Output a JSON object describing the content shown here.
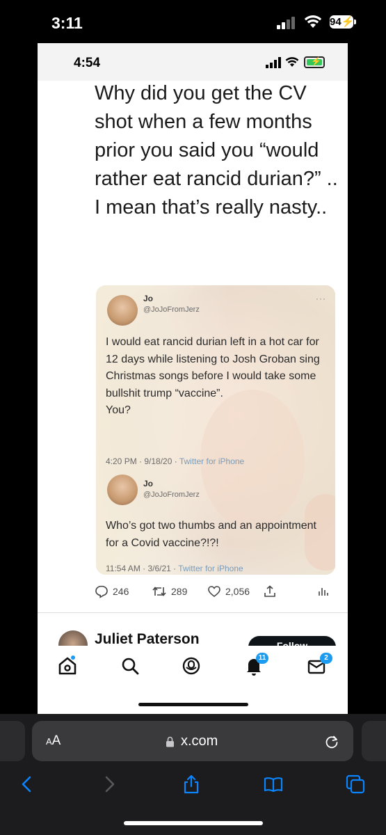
{
  "device_status": {
    "time": "3:11",
    "battery": "94"
  },
  "screenshot": {
    "status": {
      "time": "4:54"
    },
    "tweet": {
      "text": "Why did you get the CV shot when a few months prior you said you “would rather eat rancid durian?” .. I mean that’s really nasty..",
      "quote": {
        "first": {
          "name": "Jo",
          "handle": "@JoJoFromJerz",
          "more": "···",
          "body": "I would eat rancid durian left in a hot car for 12 days while listening to Josh Groban sing Christmas songs before I would take some bullshit trump “vaccine”.\nYou?",
          "time": "4:20 PM · 9/18/20 · ",
          "source": "Twitter for iPhone"
        },
        "second": {
          "name": "Jo",
          "handle": "@JoJoFromJerz",
          "body": "Who’s got two thumbs and an appointment for a Covid vaccine?!?!",
          "time": "11:54 AM · 3/6/21 · ",
          "source": "Twitter for iPhone"
        }
      },
      "actions": {
        "replies": "246",
        "retweets": "289",
        "likes": "2,056"
      }
    },
    "next_post": {
      "name": "Juliet Paterson",
      "follow_label": "Follow"
    },
    "tabbar": {
      "notifications_badge": "11",
      "messages_badge": "2"
    }
  },
  "safari": {
    "aa_label_big": "A",
    "aa_label_small": "A",
    "url": "x.com"
  },
  "colors": {
    "accent": "#1d9bf0",
    "safari_bg": "#1c1c1e",
    "toolbar_icon": "#0a84ff"
  }
}
